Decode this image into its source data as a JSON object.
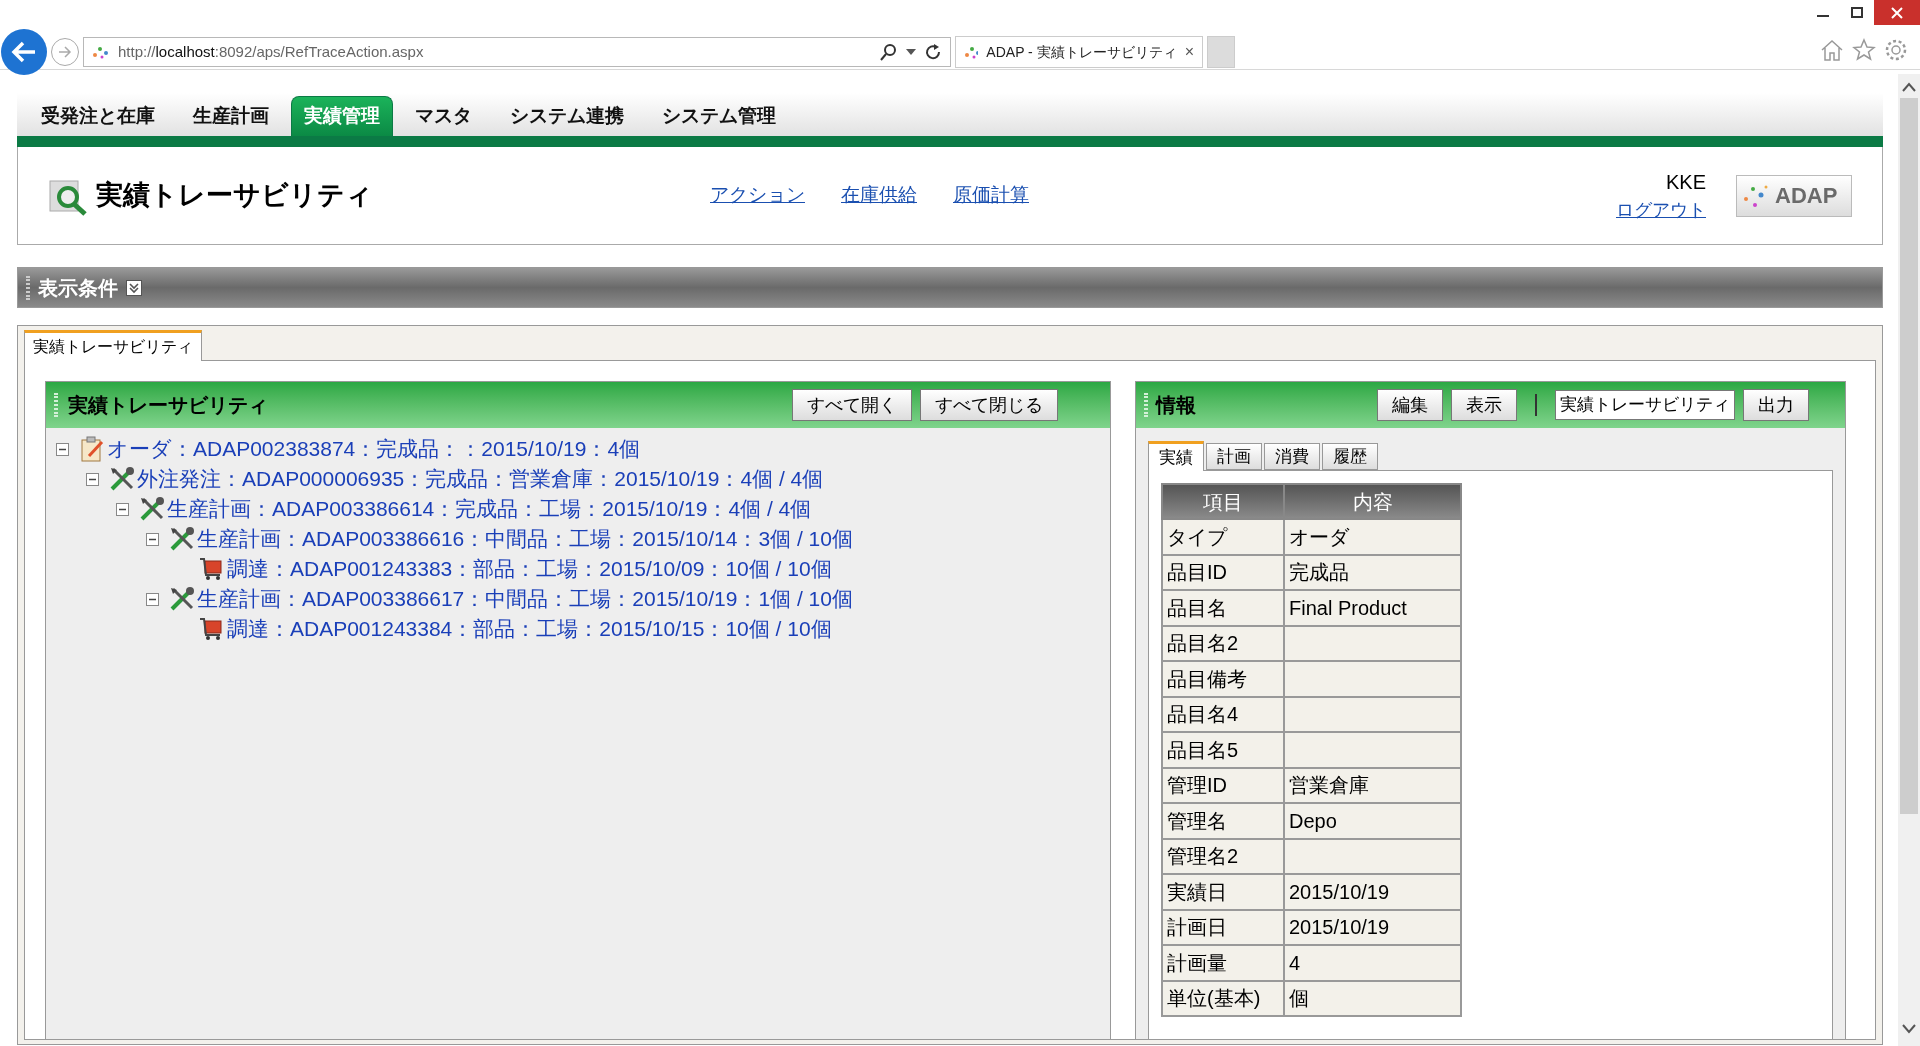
{
  "browser": {
    "url": {
      "scheme": "http://",
      "host": "localhost",
      "path": ":8092/aps/RefTraceAction.aspx"
    },
    "tab_title": "ADAP - 実績トレーサビリティ",
    "tab_close": "×"
  },
  "nav": [
    {
      "label": "受発注と在庫",
      "selected": false
    },
    {
      "label": "生産計画",
      "selected": false
    },
    {
      "label": "実績管理",
      "selected": true
    },
    {
      "label": "マスタ",
      "selected": false
    },
    {
      "label": "システム連携",
      "selected": false
    },
    {
      "label": "システム管理",
      "selected": false
    }
  ],
  "header": {
    "title": "実績トレーサビリティ",
    "links": [
      "アクション",
      "在庫供給",
      "原価計算"
    ],
    "user": "KKE",
    "logout": "ログアウト",
    "logo": "ADAP"
  },
  "conditions": {
    "title": "表示条件"
  },
  "page_tabs": [
    {
      "label": "実績トレーサビリティ",
      "selected": true
    }
  ],
  "tree_panel": {
    "title": "実績トレーサビリティ",
    "buttons": [
      "すべて開く",
      "すべて閉じる"
    ],
    "tree": [
      {
        "kind": "order",
        "text": "オーダ：ADAP002383874：完成品：：2015/10/19：4個",
        "expanded": true,
        "children": [
          {
            "kind": "plan",
            "text": "外注発注：ADAP000006935：完成品：営業倉庫：2015/10/19：4個 / 4個",
            "expanded": true,
            "children": [
              {
                "kind": "plan",
                "text": "生産計画：ADAP003386614：完成品：工場：2015/10/19：4個 / 4個",
                "expanded": true,
                "children": [
                  {
                    "kind": "plan",
                    "text": "生産計画：ADAP003386616：中間品：工場：2015/10/14：3個 / 10個",
                    "expanded": true,
                    "children": [
                      {
                        "kind": "procurement",
                        "text": "調達：ADAP001243383：部品：工場：2015/10/09：10個 / 10個"
                      }
                    ]
                  },
                  {
                    "kind": "plan",
                    "text": "生産計画：ADAP003386617：中間品：工場：2015/10/19：1個 / 10個",
                    "expanded": true,
                    "children": [
                      {
                        "kind": "procurement",
                        "text": "調達：ADAP001243384：部品：工場：2015/10/15：10個 / 10個"
                      }
                    ]
                  }
                ]
              }
            ]
          }
        ]
      }
    ]
  },
  "info_panel": {
    "title": "情報",
    "buttons": [
      "編集",
      "表示"
    ],
    "view_select": "実績トレーサビリティ",
    "output_button": "出力",
    "tabs": [
      {
        "label": "実績",
        "selected": true
      },
      {
        "label": "計画",
        "selected": false
      },
      {
        "label": "消費",
        "selected": false
      },
      {
        "label": "履歴",
        "selected": false
      }
    ],
    "table": {
      "columns": [
        "項目",
        "内容"
      ],
      "rows": [
        [
          "タイプ",
          "オーダ"
        ],
        [
          "品目ID",
          "完成品"
        ],
        [
          "品目名",
          "Final Product"
        ],
        [
          "品目名2",
          ""
        ],
        [
          "品目備考",
          ""
        ],
        [
          "品目名4",
          ""
        ],
        [
          "品目名5",
          ""
        ],
        [
          "管理ID",
          "営業倉庫"
        ],
        [
          "管理名",
          "Depo"
        ],
        [
          "管理名2",
          ""
        ],
        [
          "実績日",
          "2015/10/19"
        ],
        [
          "計画日",
          "2015/10/19"
        ],
        [
          "計画量",
          "4"
        ],
        [
          "単位(基本)",
          "個"
        ]
      ]
    }
  }
}
